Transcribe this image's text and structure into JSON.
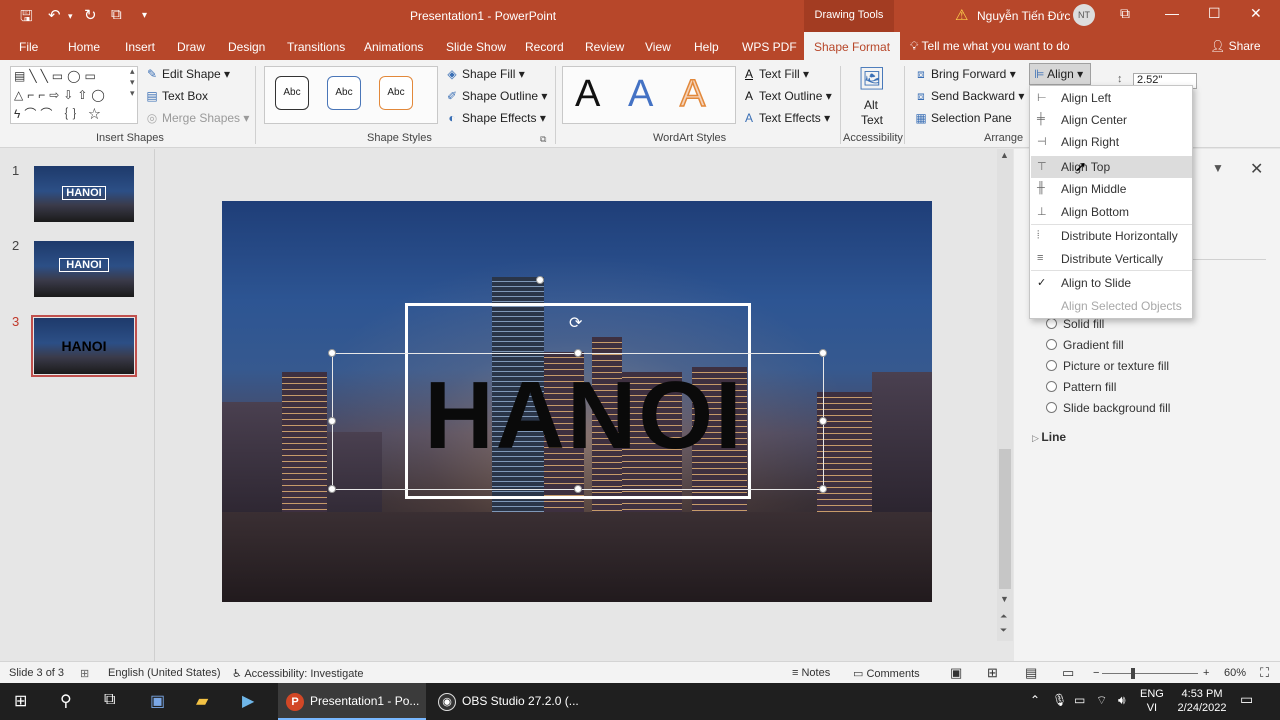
{
  "titlebar": {
    "doc_title": "Presentation1  -  PowerPoint",
    "drawing_tools": "Drawing Tools",
    "user_name": "Nguyễn Tiến Đức",
    "user_initials": "NT"
  },
  "tabs": [
    "File",
    "Home",
    "Insert",
    "Draw",
    "Design",
    "Transitions",
    "Animations",
    "Slide Show",
    "Record",
    "Review",
    "View",
    "Help",
    "WPS PDF",
    "Shape Format"
  ],
  "tell_me": "Tell me what you want to do",
  "share": "Share",
  "ribbon": {
    "insert_shapes": {
      "edit_shape": "Edit Shape",
      "text_box": "Text Box",
      "merge_shapes": "Merge Shapes",
      "label": "Insert Shapes"
    },
    "shape_styles": {
      "style_sample": "Abc",
      "shape_fill": "Shape Fill",
      "shape_outline": "Shape Outline",
      "shape_effects": "Shape Effects",
      "label": "Shape Styles"
    },
    "wordart": {
      "letter": "A",
      "text_fill": "Text Fill",
      "text_outline": "Text Outline",
      "text_effects": "Text Effects",
      "label": "WordArt Styles"
    },
    "accessibility": {
      "alt_text_1": "Alt",
      "alt_text_2": "Text",
      "label": "Accessibility"
    },
    "arrange": {
      "bring_forward": "Bring Forward",
      "send_backward": "Send Backward",
      "selection_pane": "Selection Pane",
      "align": "Align",
      "label": "Arrange"
    },
    "size": {
      "height": "2.52\""
    }
  },
  "thumbnails": [
    {
      "num": "1",
      "label": "HANOI"
    },
    {
      "num": "2",
      "label": "HANOI"
    },
    {
      "num": "3",
      "label": "HANOI"
    }
  ],
  "slide": {
    "title": "HANOI"
  },
  "align_menu": {
    "items": [
      "Align Left",
      "Align Center",
      "Align Right",
      "Align Top",
      "Align Middle",
      "Align Bottom",
      "Distribute Horizontally",
      "Distribute Vertically",
      "Align to Slide",
      "Align Selected Objects"
    ],
    "hovered": "Align Top",
    "checked": "Align to Slide"
  },
  "format_pane": {
    "fill_options": [
      "Solid fill",
      "Gradient fill",
      "Picture or texture fill",
      "Pattern fill",
      "Slide background fill"
    ],
    "line_header": "Line"
  },
  "statusbar": {
    "slide_info": "Slide 3 of 3",
    "language": "English (United States)",
    "accessibility": "Accessibility: Investigate",
    "notes": "Notes",
    "comments": "Comments",
    "zoom": "60%"
  },
  "taskbar": {
    "powerpoint_app": "Presentation1 - Po...",
    "obs_app": "OBS Studio 27.2.0 (...",
    "lang_1": "ENG",
    "lang_2": "VI",
    "time": "4:53 PM",
    "date": "2/24/2022"
  },
  "colors": {
    "accent": "#b7472a",
    "selection": "#c0504d"
  }
}
